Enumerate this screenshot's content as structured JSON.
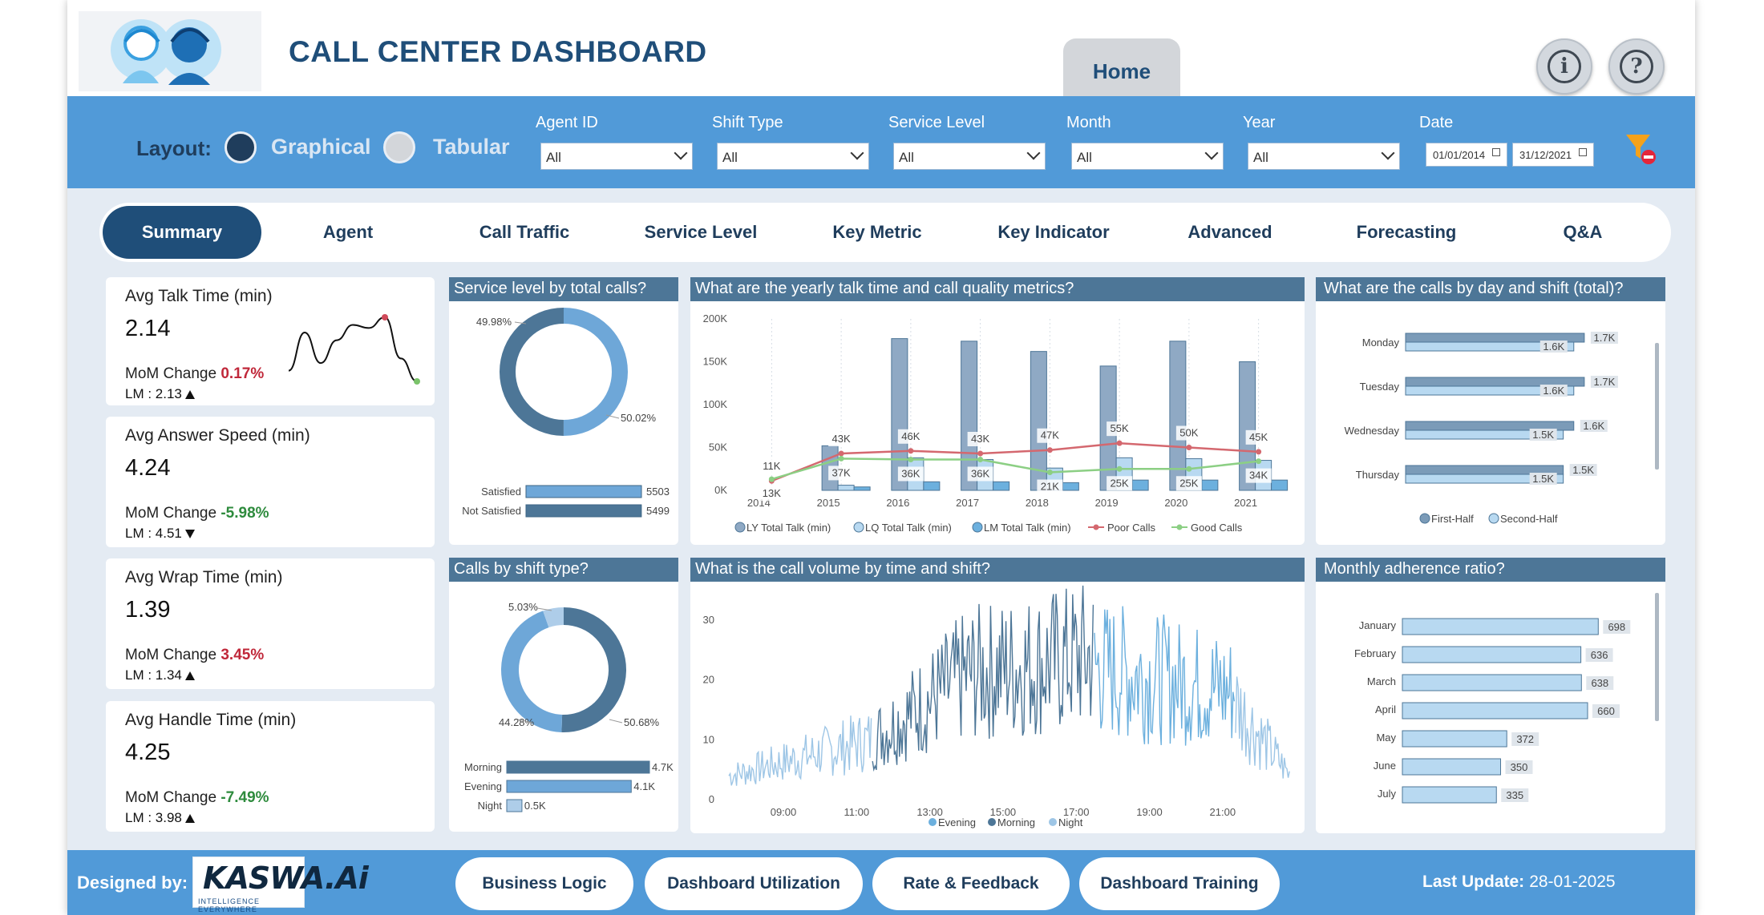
{
  "app": {
    "title": "CALL CENTER DASHBOARD",
    "home_tab": "Home"
  },
  "header": {
    "info_icon": "info-icon",
    "help_icon": "help-icon"
  },
  "filters": {
    "layout_label": "Layout:",
    "layout_options": [
      "Graphical",
      "Tabular"
    ],
    "agent_id": {
      "label": "Agent ID",
      "value": "All"
    },
    "shift_type": {
      "label": "Shift Type",
      "value": "All"
    },
    "service_level": {
      "label": "Service Level",
      "value": "All"
    },
    "month": {
      "label": "Month",
      "value": "All"
    },
    "year": {
      "label": "Year",
      "value": "All"
    },
    "date": {
      "label": "Date",
      "from": "01/01/2014",
      "to": "31/12/2021"
    },
    "clear_icon": "clear-filter-icon"
  },
  "nav": [
    "Summary",
    "Agent",
    "Call Traffic",
    "Service Level",
    "Key Metric",
    "Key Indicator",
    "Advanced",
    "Forecasting",
    "Q&A"
  ],
  "kpis": [
    {
      "title": "Avg Talk Time (min)",
      "value": "2.14",
      "change_label": "MoM Change",
      "change": "0.17%",
      "lm": "LM : 2.13",
      "trend": "up",
      "change_color": "#c0283a"
    },
    {
      "title": "Avg Answer Speed (min)",
      "value": "4.24",
      "change_label": "MoM Change",
      "change": "-5.98%",
      "lm": "LM : 4.51",
      "trend": "down",
      "change_color": "#2e8b3d"
    },
    {
      "title": "Avg Wrap Time (min)",
      "value": "1.39",
      "change_label": "MoM Change",
      "change": "3.45%",
      "lm": "LM : 1.34",
      "trend": "up",
      "change_color": "#c0283a"
    },
    {
      "title": "Avg Handle Time (min)",
      "value": "4.25",
      "change_label": "MoM Change",
      "change": "-7.49%",
      "lm": "LM : 3.98",
      "trend": "up",
      "change_color": "#2e8b3d"
    }
  ],
  "panels": {
    "service_level": "Service level by total calls?",
    "yearly": "What are the yearly talk time and call quality metrics?",
    "day_shift": "What are the calls by day and shift (total)?",
    "shift_type": "Calls by shift type?",
    "volume": "What is the call volume by time and shift?",
    "adherence": "Monthly adherence ratio?"
  },
  "chart_data": [
    {
      "type": "line",
      "title": "",
      "values": [
        1.9,
        2.15,
        1.95,
        2.1,
        2.2,
        2.18,
        2.25,
        1.98,
        1.83
      ],
      "note_first": "",
      "colors": {
        "line": "#111111"
      }
    },
    {
      "type": "pie",
      "title": "Service level by total calls?",
      "slices": [
        {
          "name": "Satisfied",
          "value": 5503,
          "pct": "50.02%"
        },
        {
          "name": "Not Satisfied",
          "value": 5499,
          "pct": "49.98%"
        }
      ],
      "bars": [
        {
          "name": "Satisfied",
          "value": 5503,
          "label": "5503"
        },
        {
          "name": "Not Satisfied",
          "value": 5499,
          "label": "5499"
        }
      ],
      "colors": [
        "#6ea7d8",
        "#4d7697"
      ]
    },
    {
      "type": "bar",
      "title": "What are the yearly talk time and call quality metrics?",
      "categories": [
        "2014",
        "2015",
        "2016",
        "2017",
        "2018",
        "2019",
        "2020",
        "2021"
      ],
      "ylim": [
        0,
        200000
      ],
      "yticks": [
        "0K",
        "50K",
        "100K",
        "150K",
        "200K"
      ],
      "series": [
        {
          "name": "LY Total Talk (min)",
          "values": [
            0,
            52000,
            177000,
            174000,
            162000,
            145000,
            174000,
            150000
          ]
        },
        {
          "name": "LQ Total Talk (min)",
          "values": [
            0,
            6000,
            38000,
            36000,
            26000,
            38000,
            37000,
            35000
          ]
        },
        {
          "name": "LM Total Talk (min)",
          "values": [
            0,
            4000,
            10000,
            10000,
            9000,
            12000,
            12000,
            12000
          ]
        },
        {
          "name": "Poor Calls",
          "values": [
            11000,
            43000,
            46000,
            43000,
            47000,
            55000,
            50000,
            45000
          ],
          "labels": [
            "11K",
            "43K",
            "46K",
            "43K",
            "47K",
            "55K",
            "50K",
            "45K"
          ]
        },
        {
          "name": "Good Calls",
          "values": [
            13000,
            37000,
            36000,
            36000,
            21000,
            25000,
            25000,
            34000
          ],
          "labels": [
            "13K",
            "37K",
            "36K",
            "36K",
            "21K",
            "25K",
            "25K",
            "34K"
          ]
        }
      ],
      "colors": {
        "ly": "#8fa9c4",
        "lq": "#b8d9f1",
        "lm": "#6cb0de",
        "poor": "#d4686f",
        "good": "#8ccf84"
      }
    },
    {
      "type": "bar",
      "title": "What are the calls by day and shift (total)?",
      "categories": [
        "Monday",
        "Tuesday",
        "Wednesday",
        "Thursday"
      ],
      "series": [
        {
          "name": "First-Half",
          "values": [
            1700,
            1700,
            1600,
            1500
          ],
          "labels": [
            "1.7K",
            "1.7K",
            "1.6K",
            "1.5K"
          ]
        },
        {
          "name": "Second-Half",
          "values": [
            1600,
            1600,
            1500,
            1500
          ],
          "labels": [
            "1.6K",
            "1.6K",
            "1.5K",
            "1.5K"
          ]
        }
      ],
      "xlim": [
        0,
        1800
      ]
    },
    {
      "type": "pie",
      "title": "Calls by shift type?",
      "slices": [
        {
          "name": "Morning",
          "value": 4700,
          "pct": "50.68%"
        },
        {
          "name": "Evening",
          "value": 4100,
          "pct": "44.28%"
        },
        {
          "name": "Night",
          "value": 500,
          "pct": "5.03%"
        }
      ],
      "bars": [
        {
          "name": "Morning",
          "value": 4700,
          "label": "4.7K"
        },
        {
          "name": "Evening",
          "value": 4100,
          "label": "4.1K"
        },
        {
          "name": "Night",
          "value": 500,
          "label": "0.5K"
        }
      ],
      "colors": [
        "#4d7697",
        "#6ea7d8",
        "#aecde9"
      ]
    },
    {
      "type": "area",
      "title": "What is the call volume by time and shift?",
      "x_ticks": [
        "09:00",
        "11:00",
        "13:00",
        "15:00",
        "17:00",
        "19:00",
        "21:00"
      ],
      "ylim": [
        0,
        30
      ],
      "yticks": [
        "0",
        "10",
        "20",
        "30"
      ],
      "series": [
        {
          "name": "Evening"
        },
        {
          "name": "Morning"
        },
        {
          "name": "Night"
        }
      ],
      "colors": {
        "evening": "#6cb0de",
        "morning": "#4d7697",
        "night": "#9ec6e6"
      }
    },
    {
      "type": "bar",
      "title": "Monthly adherence ratio?",
      "categories": [
        "January",
        "February",
        "March",
        "April",
        "May",
        "June",
        "July"
      ],
      "values": [
        698,
        636,
        638,
        660,
        372,
        350,
        335
      ],
      "labels": [
        "698",
        "636",
        "638",
        "660",
        "372",
        "350",
        "335"
      ],
      "xlim": [
        0,
        720
      ]
    }
  ],
  "footer": {
    "designed_by": "Designed by:",
    "logo_text": "KASWA.Ai",
    "logo_tag": "INTELLIGENCE EVERYWHERE",
    "buttons": [
      "Business Logic",
      "Dashboard Utilization",
      "Rate & Feedback",
      "Dashboard Training"
    ],
    "last_update_label": "Last Update:",
    "last_update": "28-01-2025"
  }
}
